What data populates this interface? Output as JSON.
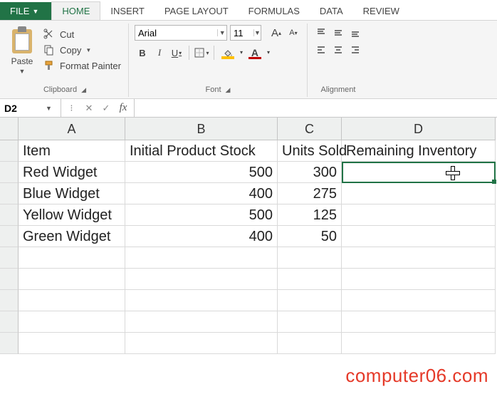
{
  "tabs": {
    "file": "FILE",
    "items": [
      "HOME",
      "INSERT",
      "PAGE LAYOUT",
      "FORMULAS",
      "DATA",
      "REVIEW"
    ],
    "active_index": 0
  },
  "ribbon": {
    "clipboard": {
      "label": "Clipboard",
      "paste": "Paste",
      "cut": "Cut",
      "copy": "Copy",
      "format_painter": "Format Painter"
    },
    "font": {
      "label": "Font",
      "name": "Arial",
      "size": "11",
      "grow": "A",
      "shrink": "A",
      "bold": "B",
      "italic": "I",
      "underline": "U",
      "font_color_letter": "A",
      "accent_red": "#c00000",
      "accent_yellow": "#ffc000"
    },
    "alignment": {
      "label": "Alignment"
    }
  },
  "formula_bar": {
    "cell_ref": "D2",
    "fx": "fx",
    "value": ""
  },
  "grid": {
    "columns": [
      "A",
      "B",
      "C",
      "D"
    ],
    "headers": {
      "A": "Item",
      "B": "Initial Product Stock",
      "C": "Units Sold",
      "D": "Remaining Inventory"
    },
    "rows": [
      {
        "A": "Red Widget",
        "B": "500",
        "C": "300",
        "D": ""
      },
      {
        "A": "Blue Widget",
        "B": "400",
        "C": "275",
        "D": ""
      },
      {
        "A": "Yellow Widget",
        "B": "500",
        "C": "125",
        "D": ""
      },
      {
        "A": "Green Widget",
        "B": "400",
        "C": "50",
        "D": ""
      }
    ],
    "active_cell": "D2"
  },
  "watermark": "computer06.com"
}
